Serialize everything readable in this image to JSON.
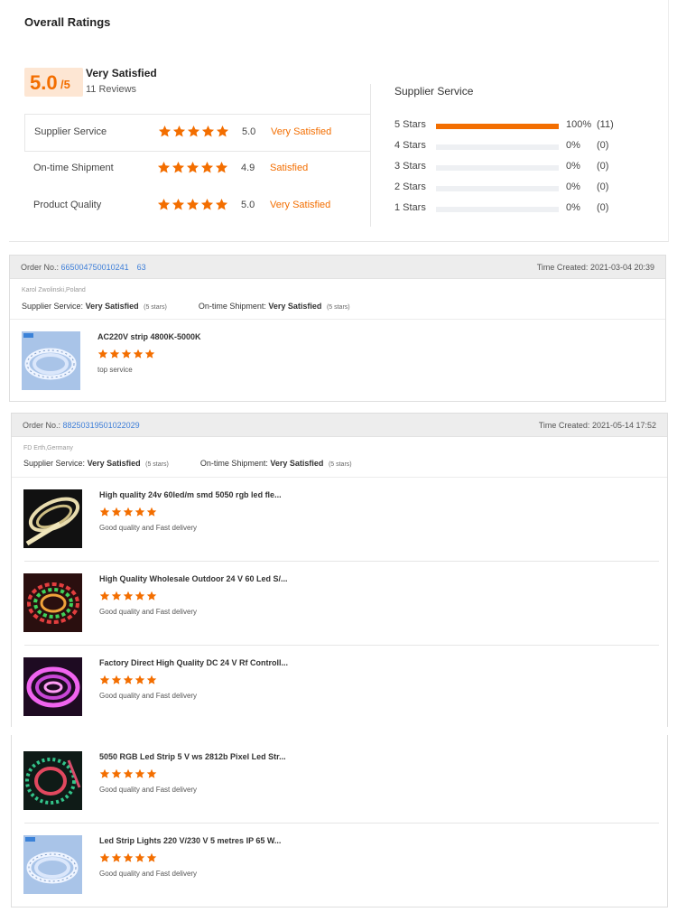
{
  "overall": {
    "title": "Overall Ratings",
    "score": "5.0",
    "score_suffix": "/5",
    "satisfaction": "Very Satisfied",
    "review_count": "11 Reviews",
    "categories": [
      {
        "label": "Supplier Service",
        "stars": 5,
        "value": "5.0",
        "satisfaction": "Very Satisfied"
      },
      {
        "label": "On-time Shipment",
        "stars": 5,
        "value": "4.9",
        "satisfaction": "Satisfied"
      },
      {
        "label": "Product Quality",
        "stars": 5,
        "value": "5.0",
        "satisfaction": "Very Satisfied"
      }
    ],
    "distribution_title": "Supplier Service",
    "distribution": [
      {
        "label": "5 Stars",
        "fraction": 1.0,
        "percent": "100%",
        "count": "(11)"
      },
      {
        "label": "4 Stars",
        "fraction": 0,
        "percent": "0%",
        "count": "(0)"
      },
      {
        "label": "3 Stars",
        "fraction": 0,
        "percent": "0%",
        "count": "(0)"
      },
      {
        "label": "2 Stars",
        "fraction": 0,
        "percent": "0%",
        "count": "(0)"
      },
      {
        "label": "1 Stars",
        "fraction": 0,
        "percent": "0%",
        "count": "(0)"
      }
    ]
  },
  "orders": [
    {
      "order_label": "Order No.:",
      "order_number": "665004750010241 63",
      "time_label": "Time Created:",
      "time": "2021-03-04 20:39",
      "buyer": "Karol Zwolinski,Poland",
      "supplier_service_label": "Supplier Service:",
      "supplier_service_value": "Very Satisfied",
      "supplier_service_stars": "(5 stars)",
      "shipment_label": "On-time Shipment:",
      "shipment_value": "Very Satisfied",
      "shipment_stars": "(5 stars)",
      "items": [
        {
          "title": "AC220V strip 4800K-5000K",
          "stars": 5,
          "comment": "top service",
          "thumb": "white-strip-reel"
        }
      ]
    },
    {
      "order_label": "Order No.:",
      "order_number": "88250319501022029",
      "time_label": "Time Created:",
      "time": "2021-05-14 17:52",
      "buyer": "FD Erth,Germany",
      "supplier_service_label": "Supplier Service:",
      "supplier_service_value": "Very Satisfied",
      "supplier_service_stars": "(5 stars)",
      "shipment_label": "On-time Shipment:",
      "shipment_value": "Very Satisfied",
      "shipment_stars": "(5 stars)",
      "items": [
        {
          "title": "High quality 24v 60led/m smd 5050 rgb led fle...",
          "stars": 5,
          "comment": "Good quality and Fast delivery",
          "thumb": "warm-white-strip"
        },
        {
          "title": "High Quality Wholesale Outdoor 24 V 60 Led S/...",
          "stars": 5,
          "comment": "Good quality and Fast delivery",
          "thumb": "rgb-strip-reel"
        },
        {
          "title": "Factory Direct High Quality DC 24 V Rf Controll...",
          "stars": 5,
          "comment": "Good quality and Fast delivery",
          "thumb": "pink-strip-reel"
        },
        {
          "title": "5050 RGB Led Strip 5 V ws 2812b Pixel Led Str...",
          "stars": 5,
          "comment": "Good quality and Fast delivery",
          "thumb": "pixel-strip-reel"
        },
        {
          "title": "Led Strip Lights 220 V/230 V 5 metres IP 65 W...",
          "stars": 5,
          "comment": "Good quality and Fast delivery",
          "thumb": "white-strip-reel"
        }
      ]
    }
  ],
  "colors": {
    "accent": "#f36e00",
    "link": "#3d7ed8",
    "score_bg": "#fde6d3"
  }
}
